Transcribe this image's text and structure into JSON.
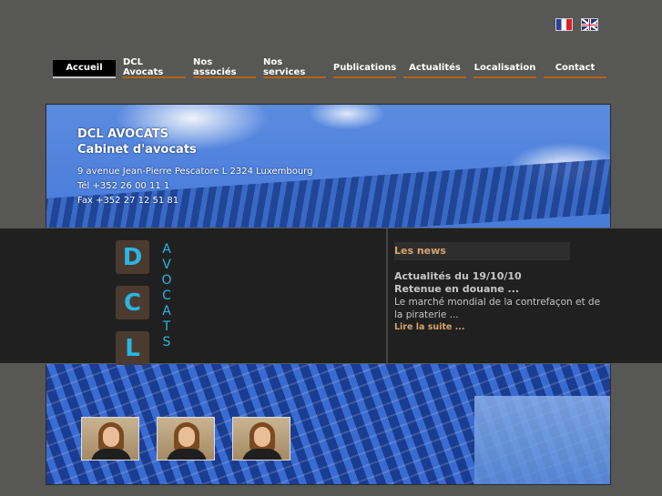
{
  "languages": [
    {
      "name": "fr",
      "icon": "french-flag-icon"
    },
    {
      "name": "en",
      "icon": "uk-flag-icon"
    }
  ],
  "nav": {
    "items": [
      "Accueil",
      "DCL Avocats",
      "Nos associés",
      "Nos services",
      "Publications",
      "Actualités",
      "Localisation",
      "Contact"
    ],
    "active": "Accueil"
  },
  "banner": {
    "title": "DCL AVOCATS",
    "subtitle": "Cabinet d'avocats",
    "address": "9 avenue Jean-Pierre Pescatore L 2324 Luxembourg",
    "tel": "Tél +352 26 00 11 1",
    "fax": "Fax +352 27 12 51 81"
  },
  "logo": {
    "letters": [
      "D",
      "C",
      "L"
    ],
    "word_letters": [
      "A",
      "V",
      "O",
      "C",
      "A",
      "T",
      "S"
    ]
  },
  "news": {
    "heading": "Les news",
    "date": "Actualités du 19/10/10",
    "title": "Retenue en douane ...",
    "text": "Le marché mondial de la contrefaçon et de la piraterie ...",
    "more": "Lire la suite ..."
  },
  "colors": {
    "background": "#575755",
    "accent": "#b3621a",
    "logo_blue": "#2ab6e0",
    "news_orange": "#d8a36c"
  }
}
